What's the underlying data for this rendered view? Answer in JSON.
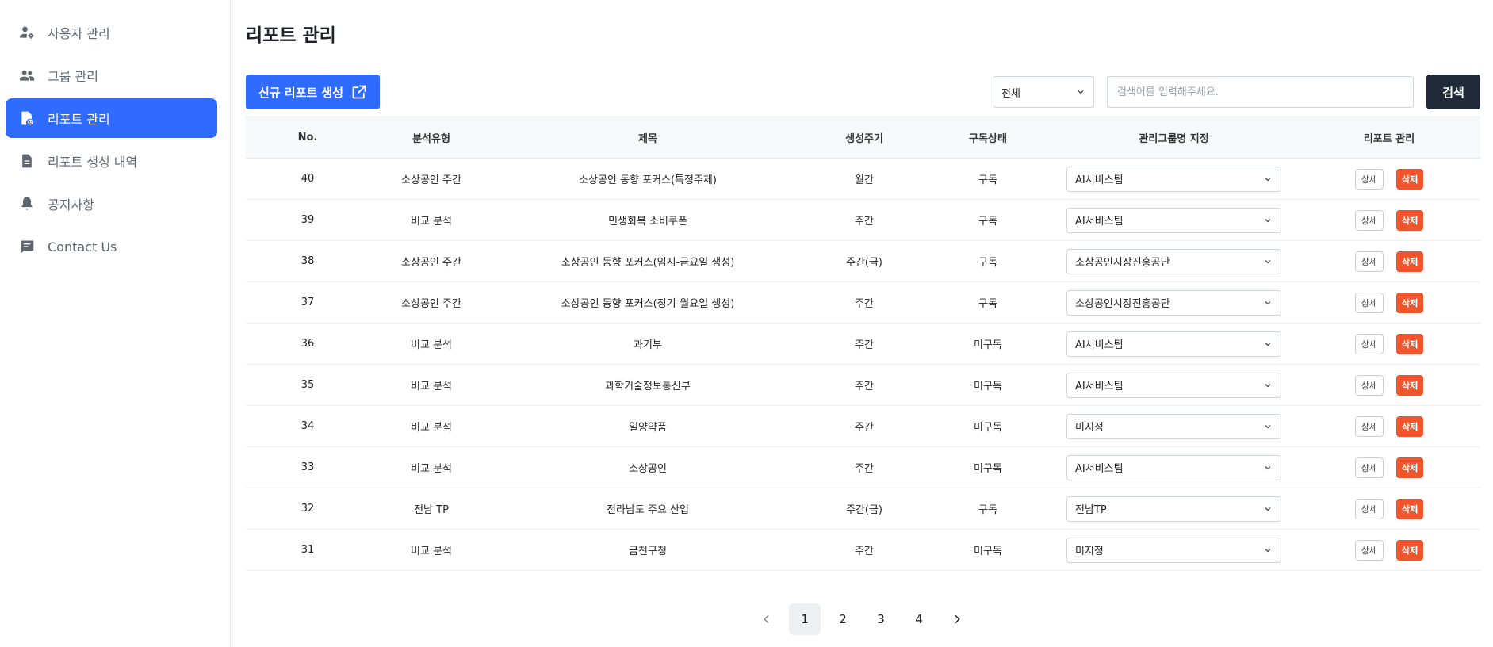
{
  "sidebar": {
    "items": [
      {
        "label": "사용자 관리",
        "icon": "user-gear-icon",
        "active": false
      },
      {
        "label": "그룹 관리",
        "icon": "group-icon",
        "active": false
      },
      {
        "label": "리포트 관리",
        "icon": "report-icon",
        "active": true
      },
      {
        "label": "리포트 생성 내역",
        "icon": "document-icon",
        "active": false
      },
      {
        "label": "공지사항",
        "icon": "bell-icon",
        "active": false
      },
      {
        "label": "Contact Us",
        "icon": "chat-icon",
        "active": false
      }
    ]
  },
  "page": {
    "title": "리포트 관리"
  },
  "toolbar": {
    "create_label": "신규 리포트 생성",
    "filter_value": "전체",
    "search_placeholder": "검색어를 입력해주세요.",
    "search_label": "검색"
  },
  "table": {
    "headers": [
      "No.",
      "분석유형",
      "제목",
      "생성주기",
      "구독상태",
      "관리그룹명 지정",
      "리포트 관리"
    ],
    "detail_label": "상세",
    "delete_label": "삭제",
    "rows": [
      {
        "no": "40",
        "type": "소상공인 주간",
        "title": "소상공인 동향 포커스(특정주제)",
        "cycle": "월간",
        "status": "구독",
        "group": "AI서비스팀"
      },
      {
        "no": "39",
        "type": "비교 분석",
        "title": "민생회복 소비쿠폰",
        "cycle": "주간",
        "status": "구독",
        "group": "AI서비스팀"
      },
      {
        "no": "38",
        "type": "소상공인 주간",
        "title": "소상공인 동향 포커스(임시-금요일 생성)",
        "cycle": "주간(금)",
        "status": "구독",
        "group": "소상공인시장진흥공단"
      },
      {
        "no": "37",
        "type": "소상공인 주간",
        "title": "소상공인 동향 포커스(정기-월요일 생성)",
        "cycle": "주간",
        "status": "구독",
        "group": "소상공인시장진흥공단"
      },
      {
        "no": "36",
        "type": "비교 분석",
        "title": "과기부",
        "cycle": "주간",
        "status": "미구독",
        "group": "AI서비스팀"
      },
      {
        "no": "35",
        "type": "비교 분석",
        "title": "과학기술정보통신부",
        "cycle": "주간",
        "status": "미구독",
        "group": "AI서비스팀"
      },
      {
        "no": "34",
        "type": "비교 분석",
        "title": "일양약품",
        "cycle": "주간",
        "status": "미구독",
        "group": "미지정"
      },
      {
        "no": "33",
        "type": "비교 분석",
        "title": "소상공인",
        "cycle": "주간",
        "status": "미구독",
        "group": "AI서비스팀"
      },
      {
        "no": "32",
        "type": "전남 TP",
        "title": "전라남도 주요 산업",
        "cycle": "주간(금)",
        "status": "구독",
        "group": "전남TP"
      },
      {
        "no": "31",
        "type": "비교 분석",
        "title": "금천구청",
        "cycle": "주간",
        "status": "미구독",
        "group": "미지정"
      }
    ]
  },
  "pagination": {
    "pages": [
      "1",
      "2",
      "3",
      "4"
    ],
    "current": "1"
  },
  "colors": {
    "accent": "#2f6bff",
    "danger": "#f2542d",
    "dark": "#1f2937"
  }
}
